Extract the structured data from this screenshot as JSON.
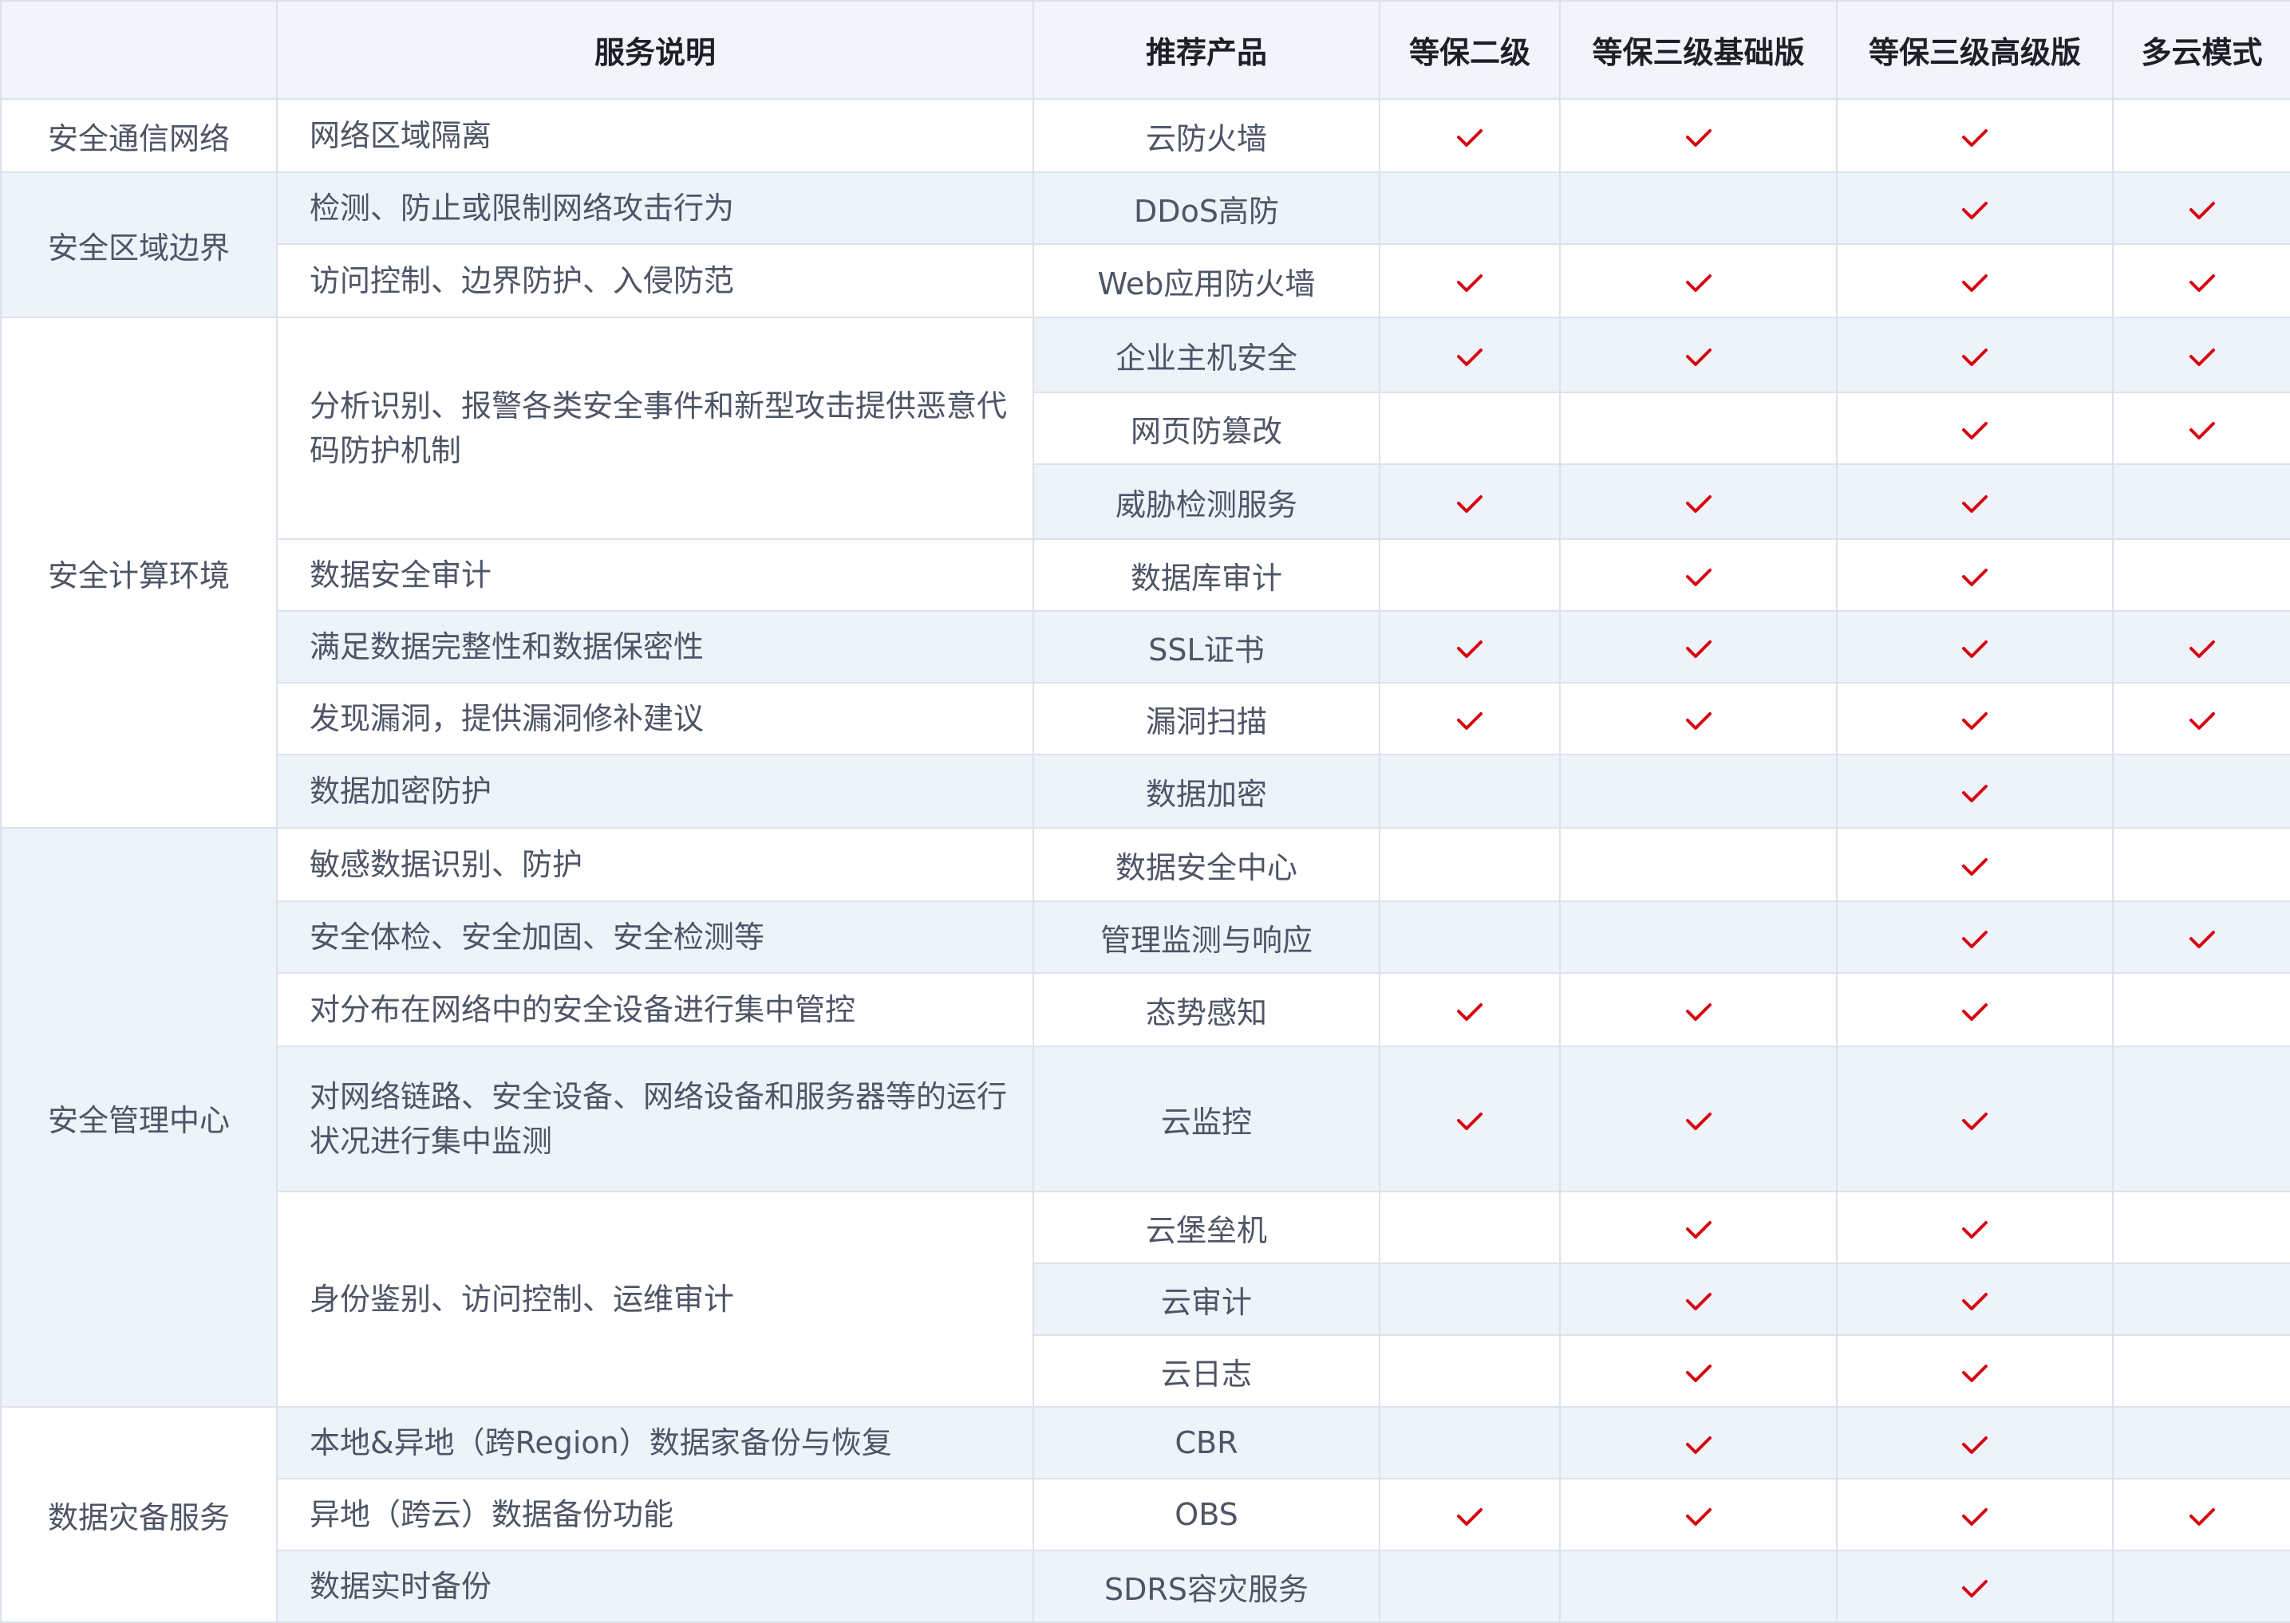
{
  "header": {
    "category": "",
    "description": "服务说明",
    "product": "推荐产品",
    "levels": [
      "等保二级",
      "等保三级基础版",
      "等保三级高级版",
      "多云模式"
    ]
  },
  "colors": {
    "border": "#dde2ea",
    "header_bg": "#f1f4f9",
    "row_shade": "#eef3fa",
    "check": "#d7000f",
    "text_dark": "#1c2029",
    "text_body": "#4d5566"
  },
  "groups": [
    {
      "category": "安全通信网络",
      "rows": [
        {
          "description": "网络区域隔离",
          "product": "云防火墙",
          "checks": [
            true,
            true,
            true,
            false
          ]
        }
      ]
    },
    {
      "category": "安全区域边界",
      "rows": [
        {
          "description": "检测、防止或限制网络攻击行为",
          "product": "DDoS高防",
          "checks": [
            false,
            false,
            true,
            true
          ]
        },
        {
          "description": "访问控制、边界防护、入侵防范",
          "product": "Web应用防火墙",
          "checks": [
            true,
            true,
            true,
            true
          ]
        }
      ]
    },
    {
      "category": "安全计算环境",
      "rows": [
        {
          "description": "分析识别、报警各类安全事件和新型攻击提供恶意代码防护机制",
          "product": "企业主机安全",
          "checks": [
            true,
            true,
            true,
            true
          ]
        },
        {
          "description": null,
          "product": "网页防篡改",
          "checks": [
            false,
            false,
            true,
            true
          ]
        },
        {
          "description": null,
          "product": "威胁检测服务",
          "checks": [
            true,
            true,
            true,
            false
          ]
        },
        {
          "description": "数据安全审计",
          "product": "数据库审计",
          "checks": [
            false,
            true,
            true,
            false
          ]
        },
        {
          "description": "满足数据完整性和数据保密性",
          "product": "SSL证书",
          "checks": [
            true,
            true,
            true,
            true
          ]
        },
        {
          "description": "发现漏洞，提供漏洞修补建议",
          "product": "漏洞扫描",
          "checks": [
            true,
            true,
            true,
            true
          ]
        },
        {
          "description": "数据加密防护",
          "product": "数据加密",
          "checks": [
            false,
            false,
            true,
            false
          ]
        }
      ]
    },
    {
      "category": "安全管理中心",
      "rows": [
        {
          "description": "敏感数据识别、防护",
          "product": "数据安全中心",
          "checks": [
            false,
            false,
            true,
            false
          ]
        },
        {
          "description": "安全体检、安全加固、安全检测等",
          "product": "管理监测与响应",
          "checks": [
            false,
            false,
            true,
            true
          ]
        },
        {
          "description": "对分布在网络中的安全设备进行集中管控",
          "product": "态势感知",
          "checks": [
            true,
            true,
            true,
            false
          ]
        },
        {
          "description": "对网络链路、安全设备、网络设备和服务器等的运行状况进行集中监测",
          "product": "云监控",
          "checks": [
            true,
            true,
            true,
            false
          ]
        },
        {
          "description": "身份鉴别、访问控制、运维审计",
          "product": "云堡垒机",
          "checks": [
            false,
            true,
            true,
            false
          ]
        },
        {
          "description": null,
          "product": "云审计",
          "checks": [
            false,
            true,
            true,
            false
          ]
        },
        {
          "description": null,
          "product": "云日志",
          "checks": [
            false,
            true,
            true,
            false
          ]
        }
      ]
    },
    {
      "category": "数据灾备服务",
      "rows": [
        {
          "description": "本地&异地（跨Region）数据家备份与恢复",
          "product": "CBR",
          "checks": [
            false,
            true,
            true,
            false
          ]
        },
        {
          "description": "异地（跨云）数据备份功能",
          "product": "OBS",
          "checks": [
            true,
            true,
            true,
            true
          ]
        },
        {
          "description": "数据实时备份",
          "product": "SDRS容灾服务",
          "checks": [
            false,
            false,
            true,
            false
          ]
        }
      ]
    }
  ]
}
